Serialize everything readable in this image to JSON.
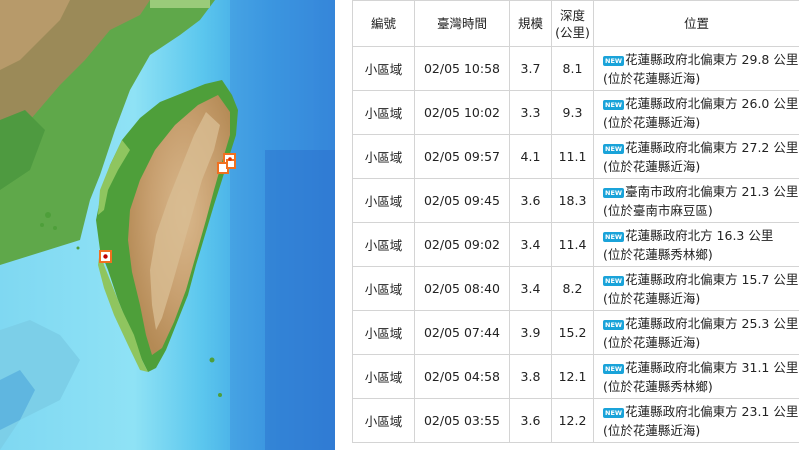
{
  "map": {
    "alt": "Taiwan relief map with earthquake epicenter markers"
  },
  "table": {
    "headers": {
      "id": "編號",
      "time": "臺灣時間",
      "magnitude": "規模",
      "depth_line1": "深度",
      "depth_line2": "(公里)",
      "location": "位置"
    },
    "rows": [
      {
        "id": "小區域",
        "time": "02/05 10:58",
        "magnitude": "3.7",
        "depth": "8.1",
        "badge": "NEW",
        "loc1": "花蓮縣政府北偏東方 29.8 公里",
        "loc2": "(位於花蓮縣近海)"
      },
      {
        "id": "小區域",
        "time": "02/05 10:02",
        "magnitude": "3.3",
        "depth": "9.3",
        "badge": "NEW",
        "loc1": "花蓮縣政府北偏東方 26.0 公里",
        "loc2": "(位於花蓮縣近海)"
      },
      {
        "id": "小區域",
        "time": "02/05 09:57",
        "magnitude": "4.1",
        "depth": "11.1",
        "badge": "NEW",
        "loc1": "花蓮縣政府北偏東方 27.2 公里",
        "loc2": "(位於花蓮縣近海)"
      },
      {
        "id": "小區域",
        "time": "02/05 09:45",
        "magnitude": "3.6",
        "depth": "18.3",
        "badge": "NEW",
        "loc1": "臺南市政府北偏東方 21.3 公里",
        "loc2": "(位於臺南市麻豆區)"
      },
      {
        "id": "小區域",
        "time": "02/05 09:02",
        "magnitude": "3.4",
        "depth": "11.4",
        "badge": "NEW",
        "loc1": "花蓮縣政府北方 16.3 公里",
        "loc2": "(位於花蓮縣秀林鄉)"
      },
      {
        "id": "小區域",
        "time": "02/05 08:40",
        "magnitude": "3.4",
        "depth": "8.2",
        "badge": "NEW",
        "loc1": "花蓮縣政府北偏東方 15.7 公里",
        "loc2": "(位於花蓮縣近海)"
      },
      {
        "id": "小區域",
        "time": "02/05 07:44",
        "magnitude": "3.9",
        "depth": "15.2",
        "badge": "NEW",
        "loc1": "花蓮縣政府北偏東方 25.3 公里",
        "loc2": "(位於花蓮縣近海)"
      },
      {
        "id": "小區域",
        "time": "02/05 04:58",
        "magnitude": "3.8",
        "depth": "12.1",
        "badge": "NEW",
        "loc1": "花蓮縣政府北偏東方 31.1 公里",
        "loc2": "(位於花蓮縣秀林鄉)"
      },
      {
        "id": "小區域",
        "time": "02/05 03:55",
        "magnitude": "3.6",
        "depth": "12.2",
        "badge": "NEW",
        "loc1": "花蓮縣政府北偏東方 23.1 公里",
        "loc2": "(位於花蓮縣近海)"
      }
    ]
  }
}
